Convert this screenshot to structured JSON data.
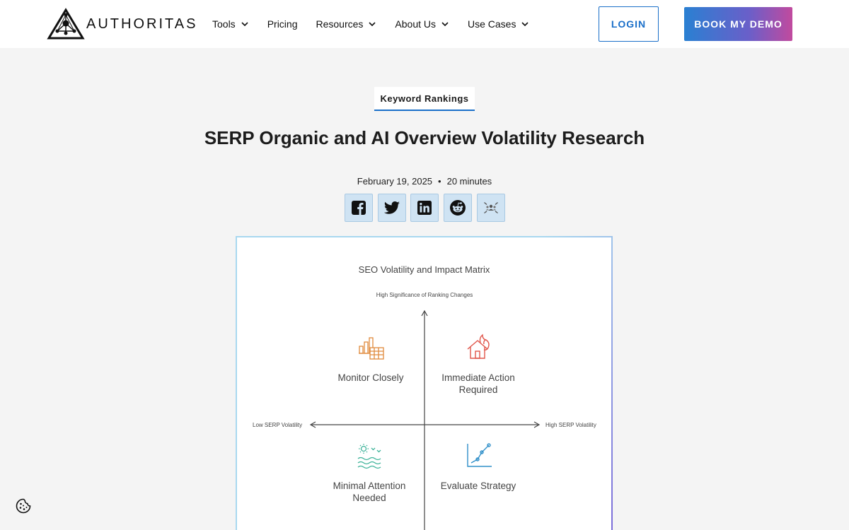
{
  "header": {
    "logo_text": "AUTHORITAS",
    "nav": [
      {
        "label": "Tools",
        "has_dropdown": true
      },
      {
        "label": "Pricing",
        "has_dropdown": false
      },
      {
        "label": "Resources",
        "has_dropdown": true
      },
      {
        "label": "About Us",
        "has_dropdown": true
      },
      {
        "label": "Use Cases",
        "has_dropdown": true
      }
    ],
    "login_label": "LOGIN",
    "demo_label": "BOOK MY DEMO"
  },
  "article": {
    "category": "Keyword Rankings",
    "title": "SERP Organic and AI Overview Volatility Research",
    "date": "February 19, 2025",
    "separator": "•",
    "read_time": "20 minutes",
    "share_icons": [
      "facebook-icon",
      "twitter-icon",
      "linkedin-icon",
      "reddit-icon",
      "community-icon"
    ]
  },
  "figure": {
    "title": "SEO Volatility and Impact Matrix",
    "y_axis_top_label": "High Significance of Ranking Changes",
    "x_axis_left_label": "Low SERP Volatility",
    "x_axis_right_label": "High SERP Volatility",
    "quadrants": {
      "top_left": {
        "label": "Monitor Closely",
        "icon": "building-chart-icon",
        "color": "#e08a3c"
      },
      "top_right": {
        "label": "Immediate Action Required",
        "icon": "house-fire-icon",
        "color": "#e0554a"
      },
      "bottom_left": {
        "label": "Minimal Attention Needed",
        "icon": "calm-sea-icon",
        "color": "#3fb39a"
      },
      "bottom_right": {
        "label": "Evaluate Strategy",
        "icon": "trend-line-icon",
        "color": "#2f8fc9"
      }
    }
  },
  "colors": {
    "accent": "#1a6fc9",
    "share_bg": "#cfe3f3",
    "page_bg": "#f4f4f4"
  }
}
